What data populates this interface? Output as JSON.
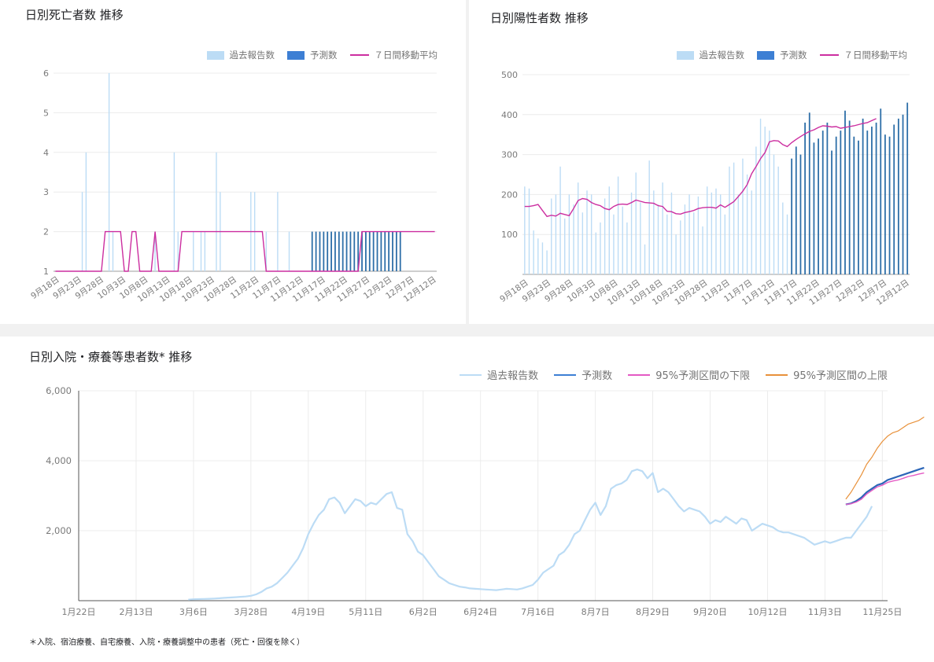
{
  "colors": {
    "past": "#bcdcf5",
    "forecast": "#3d7fd4",
    "ma": "#cc2ea0",
    "lower": "#e45ac4",
    "upper": "#e8913a",
    "grid": "#ececec",
    "axis": "#9e9e9e",
    "tick": "#7a7a7a"
  },
  "deaths": {
    "title": "日別死亡者数 推移",
    "legend": {
      "past": "過去報告数",
      "forecast": "予測数",
      "ma": "７日間移動平均"
    }
  },
  "positives": {
    "title": "日別陽性者数 推移",
    "legend": {
      "past": "過去報告数",
      "forecast": "予測数",
      "ma": "７日間移動平均"
    }
  },
  "hosp": {
    "title": "日別入院・療養等患者数* 推移",
    "legend": {
      "past": "過去報告数",
      "forecast": "予測数",
      "lower": "95%予測区間の下限",
      "upper": "95%予測区間の上限"
    },
    "footnote": "＊入院、宿泊療養、自宅療養、入院・療養調整中の患者（死亡・回復を除く）"
  },
  "chart_data": [
    {
      "type": "bar",
      "title": "日別死亡者数 推移",
      "x_start": "9月18日",
      "x_ticks": [
        "9月18日",
        "9月23日",
        "9月28日",
        "10月3日",
        "10月8日",
        "10月13日",
        "10月18日",
        "10月23日",
        "10月28日",
        "11月2日",
        "11月7日",
        "11月12日",
        "11月17日",
        "11月22日",
        "11月27日",
        "12月2日",
        "12月7日",
        "12月12日"
      ],
      "ylim": [
        1,
        6
      ],
      "y_ticks": [
        1,
        2,
        3,
        4,
        5,
        6
      ],
      "forecast_start_index": 67,
      "series": [
        {
          "name": "過去報告数",
          "type": "bar",
          "values": [
            0,
            0,
            0,
            0,
            0,
            0,
            0,
            3,
            4,
            0,
            0,
            0,
            0,
            0,
            6,
            2,
            0,
            0,
            0,
            0,
            0,
            0,
            0,
            1,
            0,
            0,
            2,
            1,
            0,
            0,
            0,
            4,
            2,
            1,
            0,
            1,
            2,
            0,
            2,
            2,
            0,
            0,
            4,
            3,
            0,
            0,
            1,
            0,
            0,
            0,
            0,
            3,
            3,
            0,
            0,
            2,
            0,
            0,
            3,
            0,
            0,
            2,
            0,
            0,
            0,
            0,
            0
          ]
        },
        {
          "name": "予測数",
          "type": "bar",
          "values": [
            2,
            2,
            2,
            2,
            2,
            2,
            2,
            2,
            2,
            2,
            2,
            2,
            2,
            2,
            2,
            2,
            2,
            2,
            2,
            2,
            2,
            2,
            2,
            2
          ]
        },
        {
          "name": "７日間移動平均",
          "type": "line",
          "values": [
            1,
            1,
            1,
            1,
            1,
            1,
            1,
            1,
            1,
            1,
            1,
            1,
            1,
            2,
            2,
            2,
            2,
            2,
            1,
            1,
            2,
            2,
            1,
            1,
            1,
            1,
            2,
            1,
            1,
            1,
            1,
            1,
            1,
            2,
            2,
            2,
            2,
            2,
            2,
            2,
            2,
            2,
            2,
            2,
            2,
            2,
            2,
            2,
            2,
            2,
            2,
            2,
            2,
            2,
            2,
            1,
            1,
            1,
            1,
            1,
            1,
            1,
            1,
            1,
            1,
            1,
            1,
            1,
            1,
            1,
            1,
            1,
            1,
            1,
            1,
            1,
            1,
            1,
            1,
            1,
            2,
            2,
            2,
            2,
            2,
            2,
            2,
            2,
            2,
            2,
            2,
            2,
            2,
            2,
            2,
            2,
            2,
            2,
            2,
            2
          ]
        }
      ]
    },
    {
      "type": "bar",
      "title": "日別陽性者数 推移",
      "x_start": "9月18日",
      "x_ticks": [
        "9月18日",
        "9月23日",
        "9月28日",
        "10月3日",
        "10月8日",
        "10月13日",
        "10月18日",
        "10月23日",
        "10月28日",
        "11月2日",
        "11月7日",
        "11月12日",
        "11月17日",
        "11月22日",
        "11月27日",
        "12月2日",
        "12月7日",
        "12月12日"
      ],
      "ylim": [
        0,
        500
      ],
      "y_ticks": [
        100,
        200,
        300,
        400,
        500
      ],
      "forecast_start_index": 60,
      "series": [
        {
          "name": "過去報告数",
          "type": "bar",
          "values": [
            220,
            215,
            110,
            90,
            80,
            60,
            190,
            200,
            270,
            140,
            200,
            175,
            230,
            155,
            210,
            200,
            105,
            130,
            190,
            220,
            150,
            245,
            170,
            130,
            205,
            255,
            180,
            75,
            285,
            210,
            175,
            230,
            150,
            205,
            100,
            135,
            175,
            200,
            155,
            195,
            120,
            220,
            205,
            215,
            200,
            150,
            270,
            280,
            200,
            290,
            250,
            210,
            320,
            390,
            370,
            360,
            300,
            270,
            180,
            150
          ]
        },
        {
          "name": "予測数",
          "type": "bar",
          "values": [
            290,
            320,
            300,
            380,
            405,
            330,
            340,
            360,
            380,
            310,
            345,
            360,
            410,
            385,
            345,
            335,
            390,
            360,
            370,
            380,
            415,
            350,
            345,
            375,
            390,
            400,
            430
          ]
        },
        {
          "name": "７日間移動平均",
          "type": "line",
          "values": [
            170,
            170,
            172,
            175,
            160,
            145,
            148,
            146,
            153,
            150,
            147,
            165,
            185,
            190,
            188,
            180,
            175,
            172,
            165,
            162,
            170,
            175,
            176,
            175,
            180,
            186,
            183,
            180,
            179,
            178,
            172,
            170,
            158,
            157,
            152,
            151,
            155,
            157,
            160,
            165,
            167,
            168,
            168,
            166,
            174,
            168,
            175,
            182,
            195,
            208,
            225,
            252,
            270,
            290,
            305,
            332,
            335,
            334,
            325,
            320,
            330,
            338,
            345,
            352,
            358,
            362,
            368,
            372,
            371,
            369,
            370,
            366,
            368,
            370,
            372,
            375,
            378,
            380,
            385,
            390
          ]
        }
      ]
    },
    {
      "type": "line",
      "title": "日別入院・療養等患者数* 推移",
      "x_ticks": [
        "1月22日",
        "2月13日",
        "3月6日",
        "3月28日",
        "4月19日",
        "5月11日",
        "6月2日",
        "6月24日",
        "7月16日",
        "8月7日",
        "8月29日",
        "9月20日",
        "10月12日",
        "11月3日",
        "11月25日"
      ],
      "x_start": "1月22日",
      "ylim": [
        0,
        6000
      ],
      "y_ticks": [
        2000,
        4000,
        6000
      ],
      "y_tick_labels": [
        "2,000",
        "4,000",
        "6,000"
      ],
      "series": [
        {
          "name": "過去報告数",
          "x_start_day": 42,
          "values": [
            30,
            40,
            45,
            50,
            55,
            60,
            70,
            80,
            90,
            100,
            110,
            120,
            140,
            180,
            250,
            350,
            400,
            500,
            650,
            800,
            1000,
            1200,
            1500,
            1900,
            2200,
            2450,
            2600,
            2900,
            2950,
            2800,
            2500,
            2700,
            2900,
            2850,
            2700,
            2800,
            2750,
            2900,
            3050,
            3100,
            2650,
            2600,
            1900,
            1700,
            1400,
            1300,
            1100,
            900,
            700,
            600,
            500,
            450,
            400,
            380,
            350,
            340,
            330,
            320,
            310,
            300,
            320,
            340,
            330,
            320,
            350,
            400,
            450,
            600,
            800,
            900,
            1000,
            1300,
            1400,
            1600,
            1900,
            2000,
            2300,
            2600,
            2800,
            2450,
            2700,
            3200,
            3300,
            3350,
            3450,
            3700,
            3750,
            3700,
            3500,
            3650,
            3100,
            3200,
            3100,
            2900,
            2700,
            2550,
            2650,
            2600,
            2550,
            2400,
            2200,
            2300,
            2250,
            2400,
            2300,
            2200,
            2350,
            2300,
            2000,
            2100,
            2200,
            2150,
            2100,
            2000,
            1950,
            1950,
            1900,
            1850,
            1800,
            1700,
            1600,
            1650,
            1700,
            1650,
            1700,
            1750,
            1800,
            1800,
            2000,
            2200,
            2400,
            2700
          ]
        },
        {
          "name": "予測数",
          "x_start_day": 294,
          "values": [
            2750,
            2780,
            2850,
            2950,
            3100,
            3200,
            3300,
            3350,
            3450,
            3500,
            3550,
            3600,
            3650,
            3700,
            3750,
            3800
          ]
        },
        {
          "name": "95%予測区間の下限",
          "x_start_day": 294,
          "values": [
            2750,
            2770,
            2820,
            2900,
            3050,
            3150,
            3250,
            3300,
            3380,
            3420,
            3450,
            3500,
            3550,
            3580,
            3620,
            3650
          ]
        },
        {
          "name": "95%予測区間の上限",
          "x_start_day": 294,
          "values": [
            2900,
            3100,
            3350,
            3600,
            3900,
            4100,
            4350,
            4550,
            4700,
            4800,
            4850,
            4950,
            5050,
            5100,
            5150,
            5250
          ]
        }
      ]
    }
  ]
}
